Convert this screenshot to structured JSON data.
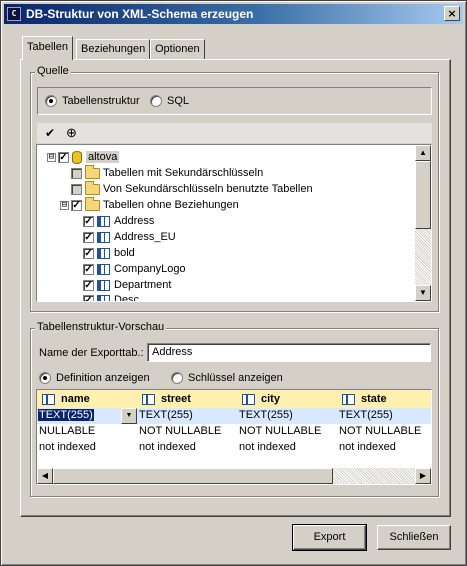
{
  "window": {
    "icon_glyph": "C",
    "title": "DB-Struktur von XML-Schema erzeugen",
    "close_glyph": "×"
  },
  "tabs": [
    {
      "label": "Tabellen",
      "active": true
    },
    {
      "label": "Beziehungen",
      "active": false
    },
    {
      "label": "Optionen",
      "active": false
    }
  ],
  "source": {
    "group_label": "Quelle",
    "radio_options": [
      {
        "label": "Tabellenstruktur",
        "selected": true
      },
      {
        "label": "SQL",
        "selected": false
      }
    ],
    "toolbar": {
      "check_all_glyph": "✔",
      "locate_glyph": "⊕"
    }
  },
  "tree": [
    {
      "label": "altova",
      "type": "database",
      "checked": true,
      "expander": "⊟",
      "highlight": true
    },
    {
      "label": "Tabellen mit Sekundärschlüsseln",
      "type": "folder",
      "checked": false
    },
    {
      "label": "Von Sekundärschlüsseln benutzte Tabellen",
      "type": "folder",
      "checked": false
    },
    {
      "label": "Tabellen ohne Beziehungen",
      "type": "folder",
      "checked": true,
      "expander": "⊟"
    },
    {
      "label": "Address",
      "type": "table",
      "checked": true
    },
    {
      "label": "Address_EU",
      "type": "table",
      "checked": true
    },
    {
      "label": "bold",
      "type": "table",
      "checked": true
    },
    {
      "label": "CompanyLogo",
      "type": "table",
      "checked": true
    },
    {
      "label": "Department",
      "type": "table",
      "checked": true
    },
    {
      "label": "Desc",
      "type": "table",
      "checked": true
    }
  ],
  "preview": {
    "group_label": "Tabellenstruktur-Vorschau",
    "export_label": "Name der Exporttab.:",
    "export_value": "Address",
    "radio_options": [
      {
        "label": "Definition anzeigen",
        "selected": true
      },
      {
        "label": "Schlüssel anzeigen",
        "selected": false
      }
    ],
    "columns": [
      "name",
      "street",
      "city",
      "state"
    ],
    "rows": [
      [
        "TEXT(255)",
        "TEXT(255)",
        "TEXT(255)",
        "TEXT(255)"
      ],
      [
        "NULLABLE",
        "NOT NULLABLE",
        "NOT NULLABLE",
        "NOT NULLABLE"
      ],
      [
        "not indexed",
        "not indexed",
        "not indexed",
        "not indexed"
      ]
    ],
    "dropdown_glyph": "▼"
  },
  "scroll_glyphs": {
    "up": "▲",
    "down": "▼",
    "left": "◀",
    "right": "▶"
  },
  "buttons": {
    "export": "Export",
    "close": "Schließen"
  }
}
